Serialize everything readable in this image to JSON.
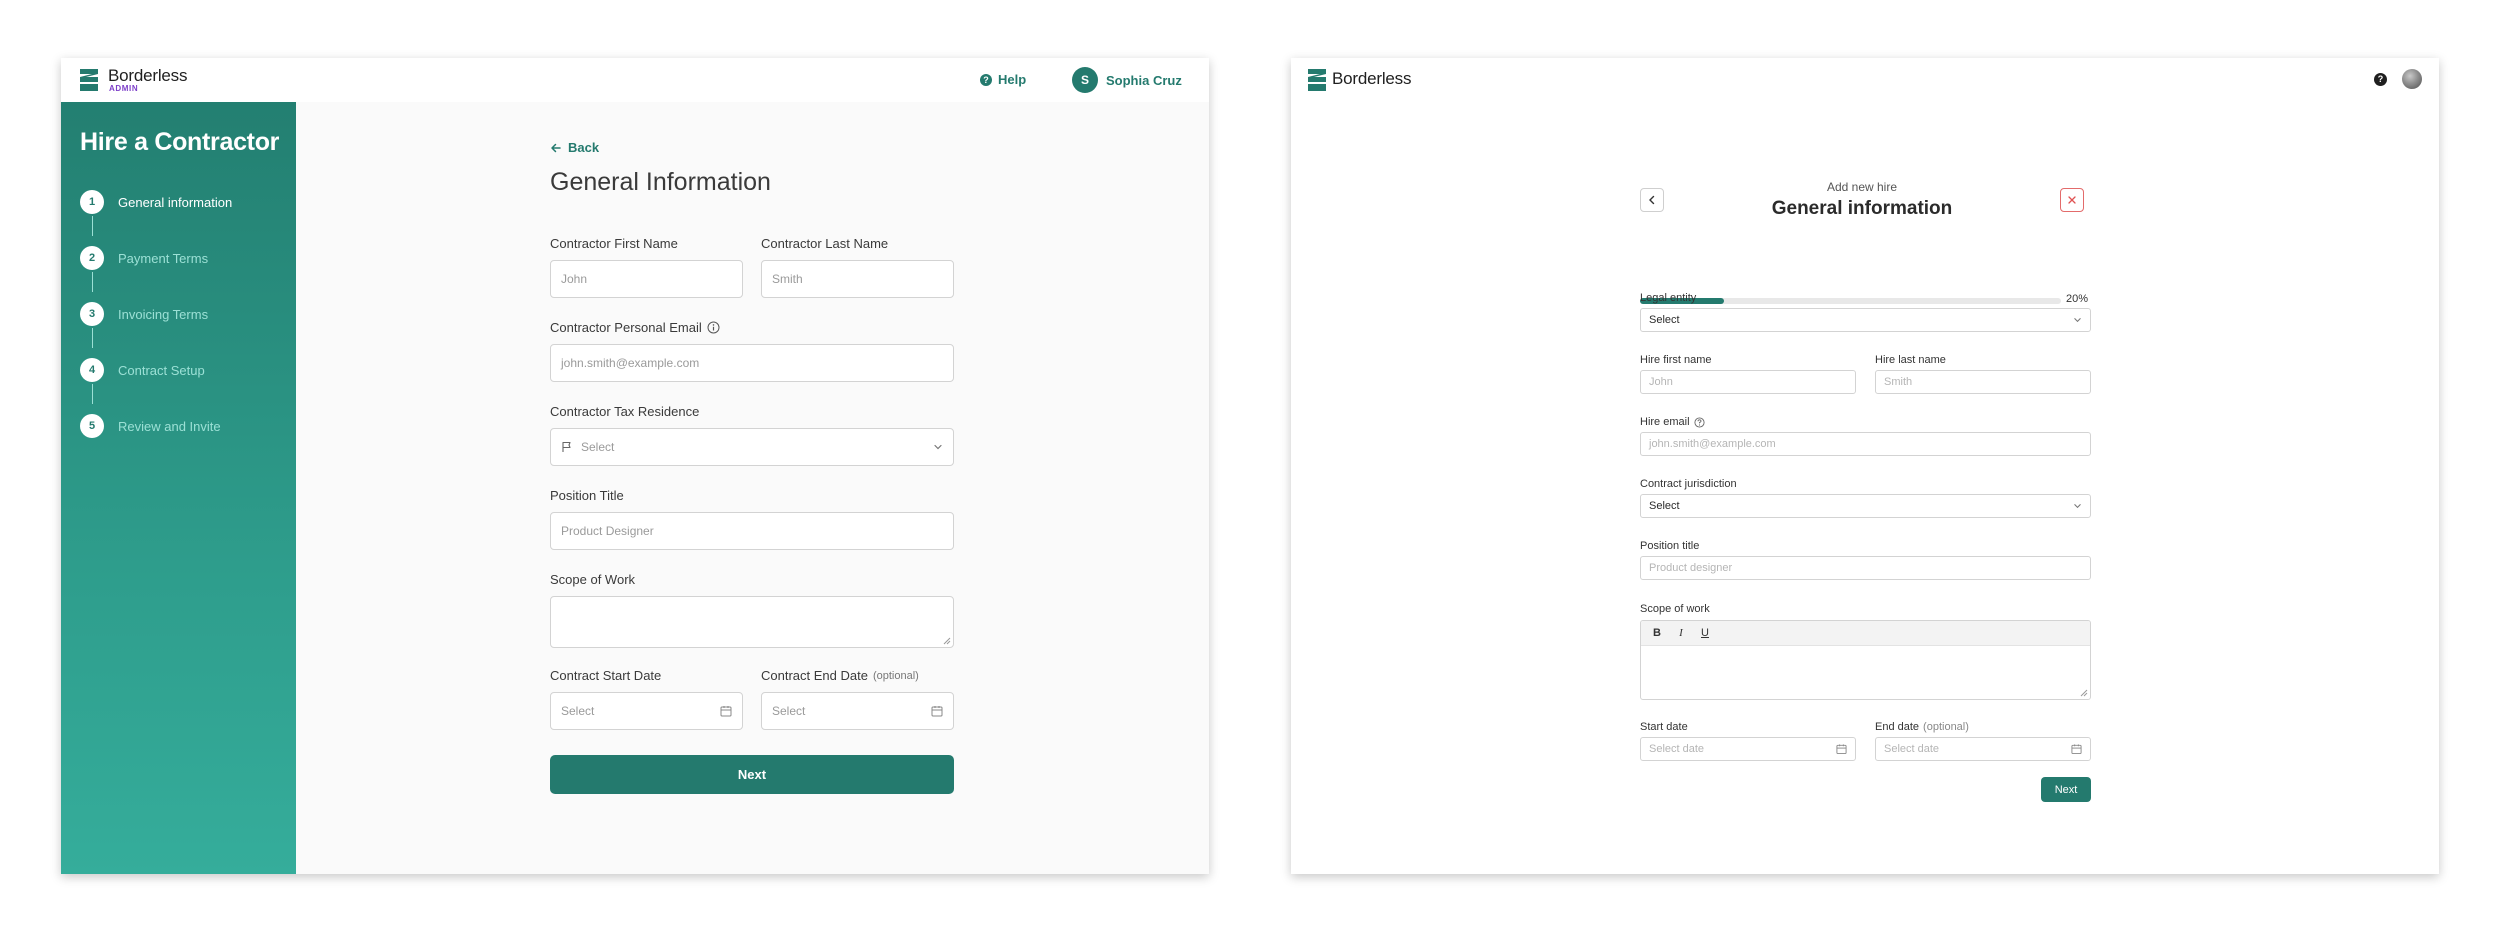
{
  "left_screen": {
    "header": {
      "brand": "Borderless",
      "brand_sub": "ADMIN",
      "help_label": "Help",
      "user_initial": "S",
      "user_name": "Sophia Cruz"
    },
    "sidebar": {
      "title": "Hire a Contractor",
      "steps": [
        {
          "number": "1",
          "label": "General information",
          "active": true
        },
        {
          "number": "2",
          "label": "Payment Terms",
          "active": false
        },
        {
          "number": "3",
          "label": "Invoicing Terms",
          "active": false
        },
        {
          "number": "4",
          "label": "Contract Setup",
          "active": false
        },
        {
          "number": "5",
          "label": "Review and Invite",
          "active": false
        }
      ]
    },
    "form": {
      "back_label": "Back",
      "title": "General Information",
      "first_name": {
        "label": "Contractor First Name",
        "placeholder": "John"
      },
      "last_name": {
        "label": "Contractor Last Name",
        "placeholder": "Smith"
      },
      "email": {
        "label": "Contractor Personal Email",
        "placeholder": "john.smith@example.com"
      },
      "tax_residence": {
        "label": "Contractor Tax Residence",
        "placeholder": "Select"
      },
      "position_title": {
        "label": "Position Title",
        "placeholder": "Product Designer"
      },
      "scope_of_work": {
        "label": "Scope of Work",
        "placeholder": ""
      },
      "start_date": {
        "label": "Contract Start Date",
        "placeholder": "Select"
      },
      "end_date": {
        "label": "Contract End Date",
        "optional": "(optional)",
        "placeholder": "Select"
      },
      "next_label": "Next"
    }
  },
  "right_screen": {
    "header": {
      "brand": "Borderless",
      "help_icon": "?"
    },
    "form": {
      "subtitle": "Add new hire",
      "title": "General information",
      "progress_percent": 20,
      "progress_label": "20%",
      "legal_entity": {
        "label": "Legal entity",
        "value": "Select"
      },
      "first_name": {
        "label": "Hire first name",
        "placeholder": "John"
      },
      "last_name": {
        "label": "Hire last name",
        "placeholder": "Smith"
      },
      "email": {
        "label": "Hire email",
        "placeholder": "john.smith@example.com"
      },
      "jurisdiction": {
        "label": "Contract jurisdiction",
        "value": "Select"
      },
      "position_title": {
        "label": "Position title",
        "placeholder": "Product designer"
      },
      "scope_of_work": {
        "label": "Scope of work",
        "toolbar": [
          "B",
          "I",
          "U"
        ]
      },
      "start_date": {
        "label": "Start date",
        "placeholder": "Select date"
      },
      "end_date": {
        "label": "End date",
        "optional": "(optional)",
        "placeholder": "Select date"
      },
      "next_label": "Next"
    }
  },
  "colors": {
    "accent": "#247a6e",
    "brand_sub": "#7d3fc9",
    "close": "#e05252"
  }
}
